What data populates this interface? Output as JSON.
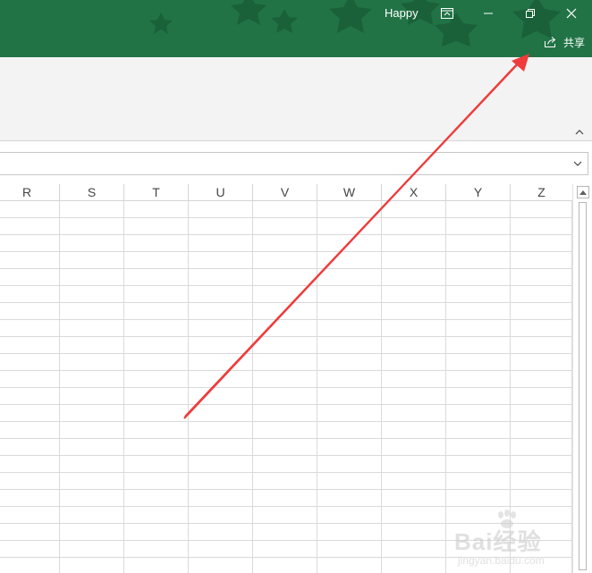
{
  "titlebar": {
    "user_name": "Happy",
    "background_color": "#217346",
    "decoration_color": "#1a6139",
    "buttons": [
      {
        "name": "ribbon-display-options",
        "icon": "ribbon-display-icon"
      },
      {
        "name": "minimize",
        "icon": "minimize-icon"
      },
      {
        "name": "restore",
        "icon": "restore-icon"
      },
      {
        "name": "close",
        "icon": "close-icon"
      }
    ]
  },
  "share": {
    "label": "共享",
    "icon": "share-icon"
  },
  "ribbon": {
    "background_color": "#f3f3f3",
    "collapse_icon": "chevron-up-icon"
  },
  "formula_bar": {
    "value": "",
    "expand_icon": "chevron-down-icon"
  },
  "columns": [
    "R",
    "S",
    "T",
    "U",
    "V",
    "W",
    "X",
    "Y",
    "Z"
  ],
  "grid": {
    "line_color": "#dadada"
  },
  "annotation": {
    "type": "arrow",
    "color": "#ef3b3b"
  },
  "watermark": {
    "text": "Bai经验",
    "subtext": "jingyan.baidu.com"
  }
}
